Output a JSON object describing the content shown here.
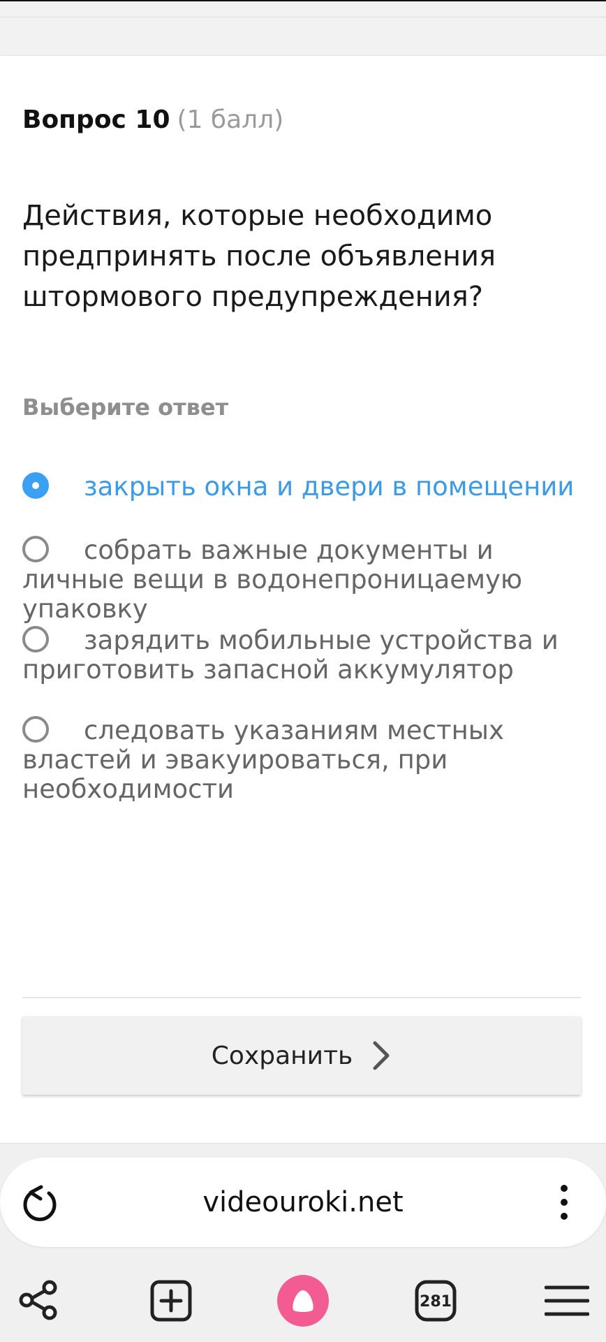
{
  "question": {
    "number_label": "Вопрос 10",
    "points_label": "(1 балл)",
    "text": "Действия, которые необходимо предпринять после объявления штормового предупреждения?"
  },
  "answer_prompt": "Выберите ответ",
  "options": [
    {
      "label": "закрыть окна и двери в помещении",
      "selected": true
    },
    {
      "label": "собрать важные документы и личные вещи в водонепроницаемую упаковку",
      "selected": false
    },
    {
      "label": "зарядить мобильные устройства и приготовить запасной аккумулятор",
      "selected": false
    },
    {
      "label": "следовать указаниям местных властей и эвакуироваться, при необходимости",
      "selected": false
    }
  ],
  "save_label": "Сохранить",
  "browser": {
    "url": "videouroki.net",
    "tab_count": "281"
  },
  "colors": {
    "accent": "#3b9ff3",
    "alice": "#f25c92"
  }
}
